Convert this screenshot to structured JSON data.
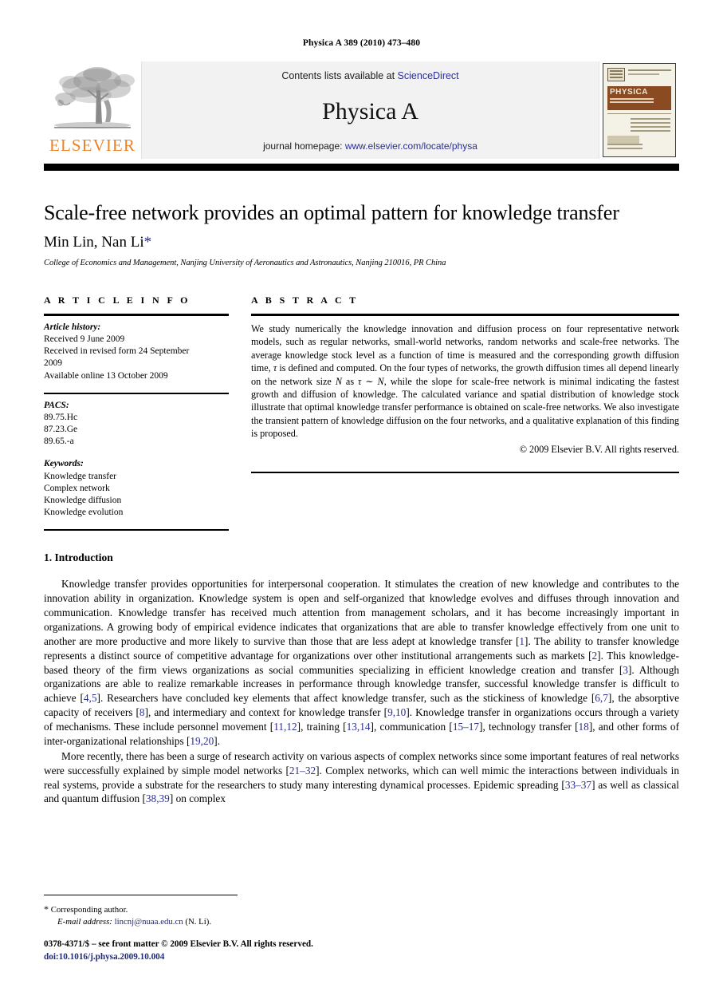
{
  "running_head": "Physica A 389 (2010) 473–480",
  "banner": {
    "contents_prefix": "Contents lists available at ",
    "sciencedirect": "ScienceDirect",
    "journal_name": "Physica A",
    "homepage_prefix": "journal homepage: ",
    "homepage_url": "www.elsevier.com/locate/physa",
    "publisher_wordmark": "ELSEVIER",
    "cover_title": "PHYSICA",
    "cover_title_a": "A",
    "cover_subtitle": "STATISTICAL MECHANICS AND ITS APPLICATIONS",
    "accent_orange": "#f08122",
    "link_blue": "#2b2f8f",
    "cover_brown": "#8a4b22"
  },
  "article": {
    "title": "Scale-free network provides an optimal pattern for knowledge transfer",
    "authors": "Min Lin, Nan Li",
    "corresponding_marker": "*",
    "affiliation": "College of Economics and Management, Nanjing University of Aeronautics and Astronautics, Nanjing 210016, PR China"
  },
  "info": {
    "heading": "A R T I C L E   I N F O",
    "history_label": "Article history:",
    "history": "Received 9 June 2009\nReceived in revised form 24 September\n2009\nAvailable online 13 October 2009",
    "pacs_label": "PACS:",
    "pacs": "89.75.Hc\n87.23.Ge\n89.65.-a",
    "keywords_label": "Keywords:",
    "keywords": "Knowledge transfer\nComplex network\nKnowledge diffusion\nKnowledge evolution"
  },
  "abstract": {
    "heading": "A B S T R A C T",
    "text_part1": "We study numerically the knowledge innovation and diffusion process on four representative network models, such as regular networks, small-world networks, random networks and scale-free networks. The average knowledge stock level as a function of time is measured and the corresponding growth diffusion time, ",
    "tau1": "τ",
    "text_part2": " is defined and computed. On the four types of networks, the growth diffusion times all depend linearly on the network size ",
    "n1": "N",
    "text_part3": " as ",
    "tau2": "τ",
    "text_part4": " ∼ ",
    "n2": "N",
    "text_part5": ", while the slope for scale-free network is minimal indicating the fastest growth and diffusion of knowledge. The calculated variance and spatial distribution of knowledge stock illustrate that optimal knowledge transfer performance is obtained on scale-free networks. We also investigate the transient pattern of knowledge diffusion on the four networks, and a qualitative explanation of this finding is proposed.",
    "copyright": "© 2009 Elsevier B.V. All rights reserved."
  },
  "introduction": {
    "heading": "1. Introduction",
    "p1_a": "Knowledge transfer provides opportunities for interpersonal cooperation. It stimulates the creation of new knowledge and contributes to the innovation ability in organization. Knowledge system is open and self-organized that knowledge evolves and diffuses through innovation and communication. Knowledge transfer has received much attention from management scholars, and it has become increasingly important in organizations. A growing body of empirical evidence indicates that organizations that are able to transfer knowledge effectively from one unit to another are more productive and more likely to survive than those that are less adept at knowledge transfer [",
    "r1": "1",
    "p1_b": "]. The ability to transfer knowledge represents a distinct source of competitive advantage for organizations over other institutional arrangements such as markets [",
    "r2": "2",
    "p1_c": "]. This knowledge-based theory of the firm views organizations as social communities specializing in efficient knowledge creation and transfer [",
    "r3": "3",
    "p1_d": "]. Although organizations are able to realize remarkable increases in performance through knowledge transfer, successful knowledge transfer is difficult to achieve [",
    "r4": "4,5",
    "p1_e": "]. Researchers have concluded key elements that affect knowledge transfer, such as the stickiness of knowledge [",
    "r5": "6,7",
    "p1_f": "], the absorptive capacity of receivers [",
    "r6": "8",
    "p1_g": "], and intermediary and context for knowledge transfer [",
    "r7": "9,10",
    "p1_h": "]. Knowledge transfer in organizations occurs through a variety of mechanisms. These include personnel movement [",
    "r8": "11,12",
    "p1_i": "], training [",
    "r9": "13,14",
    "p1_j": "], communication [",
    "r10": "15–17",
    "p1_k": "], technology transfer [",
    "r11": "18",
    "p1_l": "], and other forms of inter-organizational relationships [",
    "r12": "19,20",
    "p1_m": "].",
    "p2_a": "More recently, there has been a surge of research activity on various aspects of complex networks since some important features of real networks were successfully explained by simple model networks [",
    "r13": "21–32",
    "p2_b": "]. Complex networks, which can well mimic the interactions between individuals in real systems, provide a substrate for the researchers to study many interesting dynamical processes. Epidemic spreading [",
    "r14": "33–37",
    "p2_c": "] as well as classical and quantum diffusion [",
    "r15": "38,39",
    "p2_d": "] on complex"
  },
  "footer": {
    "corresponding_marker": "*",
    "corresponding_text": "Corresponding author.",
    "email_label": "E-mail address:",
    "email": "lincnj@nuaa.edu.cn",
    "email_owner": "(N. Li).",
    "issn_line": "0378-4371/$ – see front matter © 2009 Elsevier B.V. All rights reserved.",
    "doi_label": "doi:",
    "doi": "10.1016/j.physa.2009.10.004"
  }
}
